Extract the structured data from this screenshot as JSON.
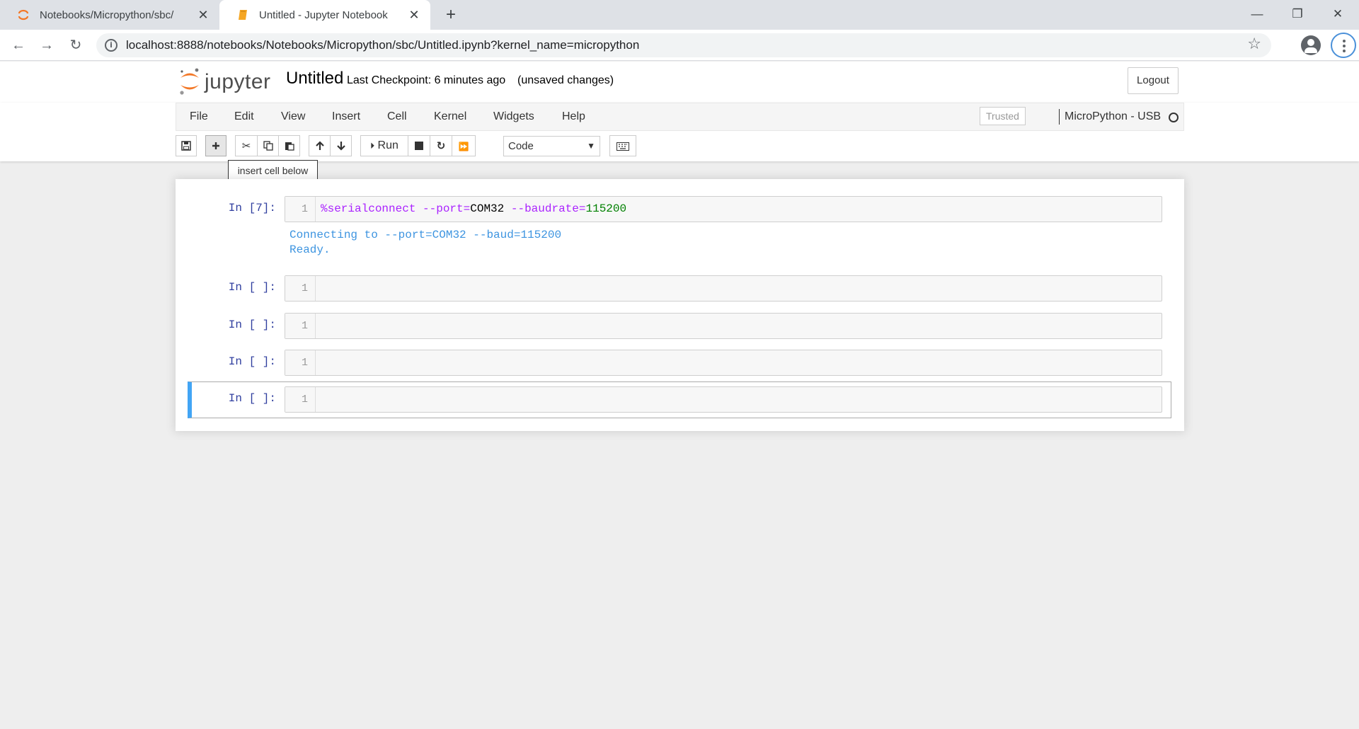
{
  "browser": {
    "tabs": [
      {
        "title": "Notebooks/Micropython/sbc/",
        "active": false
      },
      {
        "title": "Untitled - Jupyter Notebook",
        "active": true
      }
    ],
    "url": "localhost:8888/notebooks/Notebooks/Micropython/sbc/Untitled.ipynb?kernel_name=micropython"
  },
  "header": {
    "logo_text": "jupyter",
    "notebook_name": "Untitled",
    "checkpoint": "Last Checkpoint: 6 minutes ago",
    "autosave_status": "(unsaved changes)",
    "logout_label": "Logout"
  },
  "menubar": {
    "items": [
      "File",
      "Edit",
      "View",
      "Insert",
      "Cell",
      "Kernel",
      "Widgets",
      "Help"
    ],
    "trusted_label": "Trusted",
    "kernel_name": "MicroPython - USB"
  },
  "toolbar": {
    "run_label": "Run",
    "cell_type": "Code",
    "tooltip": "insert cell below"
  },
  "cells": [
    {
      "prompt": "In [7]:",
      "line_number": "1",
      "code_tokens": {
        "magic": "%serialconnect",
        "arg1_flag": " --port",
        "arg1_eq": "=",
        "arg1_val": "COM32",
        "arg2_flag": " --baudrate",
        "arg2_eq": "=",
        "arg2_val": "115200"
      },
      "output_lines": [
        "Connecting to --port=COM32 --baud=115200",
        "Ready."
      ]
    },
    {
      "prompt": "In [ ]:",
      "line_number": "1"
    },
    {
      "prompt": "In [ ]:",
      "line_number": "1"
    },
    {
      "prompt": "In [ ]:",
      "line_number": "1"
    },
    {
      "prompt": "In [ ]:",
      "line_number": "1",
      "selected": true
    }
  ],
  "colors": {
    "jupyter_orange": "#f37726",
    "selected_cell_accent": "#42a5f5",
    "prompt_blue": "#303f9f",
    "output_blue": "#3d94e0"
  }
}
